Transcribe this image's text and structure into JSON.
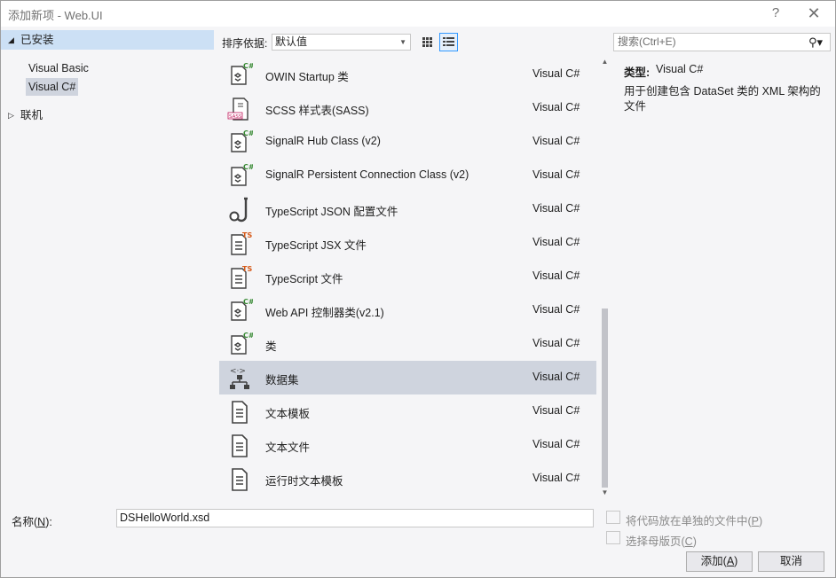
{
  "window": {
    "title": "添加新项 - Web.UI",
    "help": "?",
    "close": "✕"
  },
  "left": {
    "installed": "已安装",
    "visual_basic": "Visual Basic",
    "visual_csharp": "Visual C#",
    "online": "联机"
  },
  "toolbar": {
    "sort_label": "排序依据:",
    "sort_value": "默认值"
  },
  "search": {
    "placeholder": "搜索(Ctrl+E)"
  },
  "items": [
    {
      "name": "OWIN Startup 类",
      "lang": "Visual C#",
      "icon": "csharp-class-icon"
    },
    {
      "name": "SCSS 样式表(SASS)",
      "lang": "Visual C#",
      "icon": "scss-file-icon"
    },
    {
      "name": "SignalR Hub Class (v2)",
      "lang": "Visual C#",
      "icon": "csharp-class-icon"
    },
    {
      "name": "SignalR Persistent Connection Class (v2)",
      "lang": "Visual C#",
      "icon": "csharp-class-icon"
    },
    {
      "name": "TypeScript JSON 配置文件",
      "lang": "Visual C#",
      "icon": "json-config-icon"
    },
    {
      "name": "TypeScript JSX 文件",
      "lang": "Visual C#",
      "icon": "typescript-file-icon"
    },
    {
      "name": "TypeScript 文件",
      "lang": "Visual C#",
      "icon": "typescript-file-icon"
    },
    {
      "name": "Web API 控制器类(v2.1)",
      "lang": "Visual C#",
      "icon": "csharp-class-icon"
    },
    {
      "name": "类",
      "lang": "Visual C#",
      "icon": "csharp-class-icon"
    },
    {
      "name": "数据集",
      "lang": "Visual C#",
      "icon": "dataset-icon",
      "selected": true
    },
    {
      "name": "文本模板",
      "lang": "Visual C#",
      "icon": "text-file-icon"
    },
    {
      "name": "文本文件",
      "lang": "Visual C#",
      "icon": "text-file-icon"
    },
    {
      "name": "运行时文本模板",
      "lang": "Visual C#",
      "icon": "text-file-icon"
    }
  ],
  "detail": {
    "type_label": "类型:",
    "type_value": "Visual C#",
    "description": "用于创建包含 DataSet 类的 XML 架构的文件"
  },
  "bottom": {
    "name_label_pre": "名称(",
    "name_label_key": "N",
    "name_label_post": "):",
    "name_value": "DSHelloWorld.xsd",
    "chk1_pre": "将代码放在单独的文件中(",
    "chk1_key": "P",
    "chk1_post": ")",
    "chk2_pre": "选择母版页(",
    "chk2_key": "C",
    "chk2_post": ")",
    "add_pre": "添加(",
    "add_key": "A",
    "add_post": ")",
    "cancel": "取消"
  },
  "colors": {
    "selection": "#cfd4de",
    "installed_bg": "#cce0f5",
    "accent": "#3399ff"
  }
}
